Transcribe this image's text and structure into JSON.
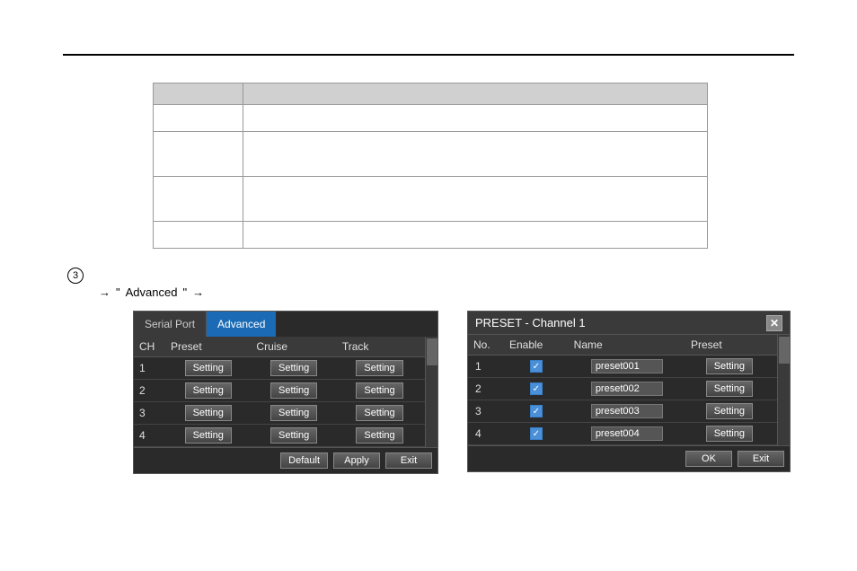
{
  "page": {
    "top_rule": true,
    "circle_number": "3",
    "arrow_text": "→",
    "quote_open": "\"",
    "quote_close": "\"",
    "arrow_text2": "→"
  },
  "main_table": {
    "col1_header": "",
    "col2_header": "",
    "rows": [
      {
        "col1": "",
        "col2": "",
        "type": "short"
      },
      {
        "col1": "",
        "col2": "",
        "type": "tall"
      },
      {
        "col1": "",
        "col2": "",
        "type": "tall"
      },
      {
        "col1": "",
        "col2": "",
        "type": "medium"
      }
    ]
  },
  "dialog_left": {
    "tab_serial": "Serial Port",
    "tab_advanced": "Advanced",
    "columns": [
      "CH",
      "Preset",
      "Cruise",
      "Track"
    ],
    "rows": [
      {
        "ch": "1",
        "preset": "Setting",
        "cruise": "Setting",
        "track": "Setting"
      },
      {
        "ch": "2",
        "preset": "Setting",
        "cruise": "Setting",
        "track": "Setting"
      },
      {
        "ch": "3",
        "preset": "Setting",
        "cruise": "Setting",
        "track": "Setting"
      },
      {
        "ch": "4",
        "preset": "Setting",
        "cruise": "Setting",
        "track": "Setting"
      }
    ],
    "footer_buttons": [
      "Default",
      "Apply",
      "Exit"
    ]
  },
  "dialog_right": {
    "title": "PRESET - Channel 1",
    "columns": [
      "No.",
      "Enable",
      "Name",
      "Preset"
    ],
    "rows": [
      {
        "no": "1",
        "enabled": true,
        "name": "preset001",
        "preset": "Setting"
      },
      {
        "no": "2",
        "enabled": true,
        "name": "preset002",
        "preset": "Setting"
      },
      {
        "no": "3",
        "enabled": true,
        "name": "preset003",
        "preset": "Setting"
      },
      {
        "no": "4",
        "enabled": true,
        "name": "preset004",
        "preset": "Setting"
      }
    ],
    "footer_buttons": [
      "OK",
      "Exit"
    ],
    "close_icon": "✕"
  }
}
